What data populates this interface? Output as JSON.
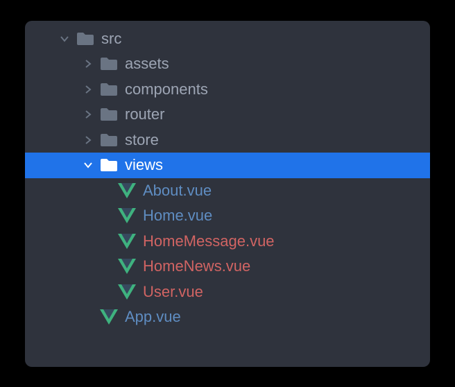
{
  "tree": {
    "src": {
      "label": "src"
    },
    "assets": {
      "label": "assets"
    },
    "components": {
      "label": "components"
    },
    "router": {
      "label": "router"
    },
    "store": {
      "label": "store"
    },
    "views": {
      "label": "views"
    },
    "about_vue": {
      "label": "About.vue"
    },
    "home_vue": {
      "label": "Home.vue"
    },
    "homemessage_vue": {
      "label": "HomeMessage.vue"
    },
    "homenews_vue": {
      "label": "HomeNews.vue"
    },
    "user_vue": {
      "label": "User.vue"
    },
    "app_vue": {
      "label": "App.vue"
    }
  },
  "colors": {
    "selected_bg": "#2073e9",
    "panel_bg": "#2f333d",
    "text_default": "#9da5b4",
    "text_blue": "#5f8dc2",
    "text_red": "#d16463",
    "vue_green": "#3fb27f",
    "vue_dark": "#36495e",
    "folder_icon": "#6a7483",
    "folder_icon_selected": "#ffffff",
    "arrow": "#6a7483",
    "arrow_selected": "#ffffff"
  }
}
